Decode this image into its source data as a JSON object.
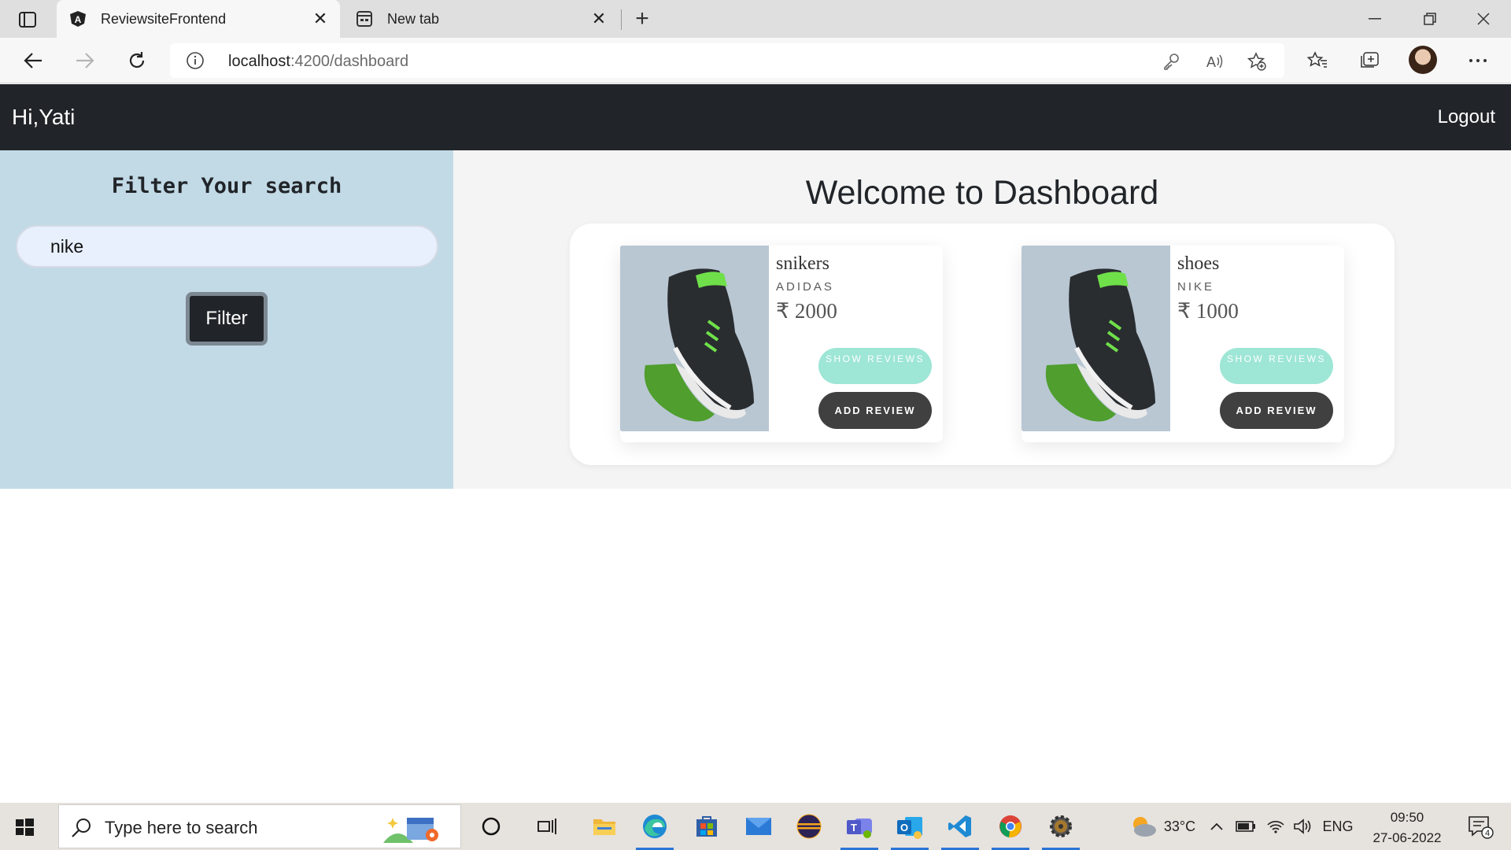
{
  "browser": {
    "tabs": [
      {
        "title": "ReviewsiteFrontend",
        "active": true
      },
      {
        "title": "New tab",
        "active": false
      }
    ],
    "url_host": "localhost",
    "url_path": ":4200/dashboard"
  },
  "nav": {
    "greeting": "Hi,Yati",
    "logout": "Logout"
  },
  "sidebar": {
    "title": "Filter Your search",
    "search_value": "nike",
    "filter_button": "Filter"
  },
  "main": {
    "title": "Welcome to Dashboard",
    "products": [
      {
        "name": "snikers",
        "brand": "ADIDAS",
        "price": "₹ 2000",
        "show_reviews": "SHOW REVIEWS",
        "add_review": "ADD REVIEW"
      },
      {
        "name": "shoes",
        "brand": "NIKE",
        "price": "₹ 1000",
        "show_reviews": "SHOW REVIEWS",
        "add_review": "ADD REVIEW"
      }
    ]
  },
  "taskbar": {
    "search_placeholder": "Type here to search",
    "temperature": "33°C",
    "language": "ENG",
    "time": "09:50",
    "date": "27-06-2022",
    "notification_count": "4"
  },
  "colors": {
    "navbar": "#212529",
    "sidebar": "#c2dae6",
    "show_reviews_button": "#9ee6d6",
    "add_review_button": "#404040"
  }
}
